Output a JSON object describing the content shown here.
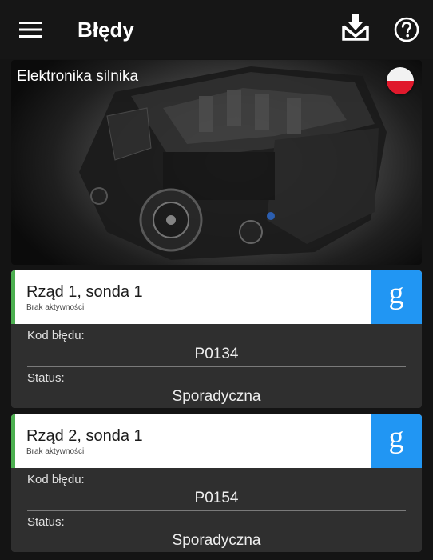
{
  "app_bar": {
    "title": "Błędy",
    "icons": [
      "menu-icon",
      "download-inbox-icon",
      "help-icon"
    ]
  },
  "banner": {
    "title": "Elektronika silnika",
    "flag": "poland-flag-icon"
  },
  "errors": [
    {
      "title": "Rząd 1, sonda 1",
      "subtitle": "Brak aktywności",
      "code_label": "Kod błędu:",
      "code": "P0134",
      "status_label": "Status:",
      "status": "Sporadyczna"
    },
    {
      "title": "Rząd 2, sonda 1",
      "subtitle": "Brak aktywności",
      "code_label": "Kod błędu:",
      "code": "P0154",
      "status_label": "Status:",
      "status": "Sporadyczna"
    }
  ],
  "colors": {
    "background": "#141414",
    "card": "#2f2f2f",
    "accent_green": "#4caf50",
    "google_blue": "#2196f3"
  }
}
